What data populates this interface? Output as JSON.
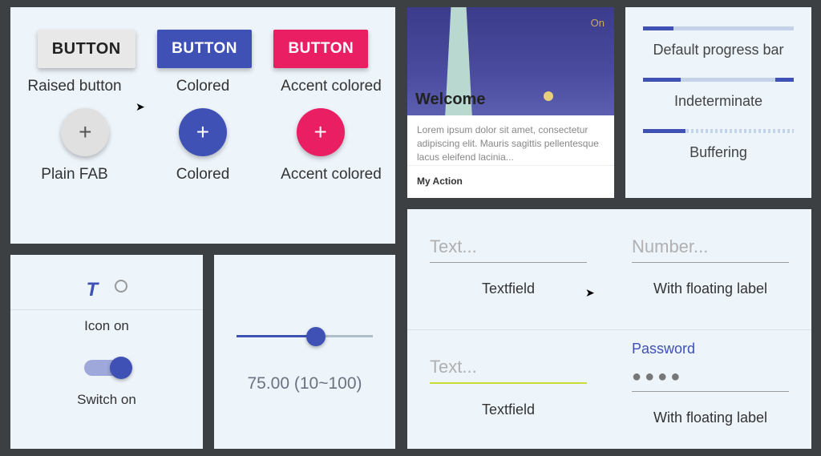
{
  "buttons": {
    "raised": {
      "label": "BUTTON",
      "caption": "Raised button"
    },
    "colored": {
      "label": "BUTTON",
      "caption": "Colored"
    },
    "accent": {
      "label": "BUTTON",
      "caption": "Accent colored"
    },
    "fab_plain": {
      "glyph": "+",
      "caption": "Plain FAB"
    },
    "fab_colored": {
      "glyph": "+",
      "caption": "Colored"
    },
    "fab_accent": {
      "glyph": "+",
      "caption": "Accent colored"
    }
  },
  "card": {
    "badge": "On",
    "title": "Welcome",
    "body": "Lorem ipsum dolor sit amet, consectetur adipiscing elit. Mauris sagittis pellentesque lacus eleifend lacinia...",
    "action": "My Action"
  },
  "progress": {
    "default": {
      "label": "Default progress bar",
      "percent": 20
    },
    "indeterminate": {
      "label": "Indeterminate"
    },
    "buffering": {
      "label": "Buffering",
      "percent": 28
    }
  },
  "toggles": {
    "icon_glyph": "T",
    "icon_caption": "Icon on",
    "switch_caption": "Switch on",
    "switch_on": true
  },
  "slider": {
    "value": 75.0,
    "min": 10,
    "max": 100,
    "display": "75.00 (10~100)"
  },
  "inputs": {
    "text1": {
      "placeholder": "Text...",
      "caption": "Textfield"
    },
    "number": {
      "placeholder": "Number...",
      "caption": "With floating label"
    },
    "text2": {
      "placeholder": "Text...",
      "caption": "Textfield"
    },
    "password": {
      "label": "Password",
      "value_mask": "●●●●",
      "caption": "With floating label"
    }
  }
}
